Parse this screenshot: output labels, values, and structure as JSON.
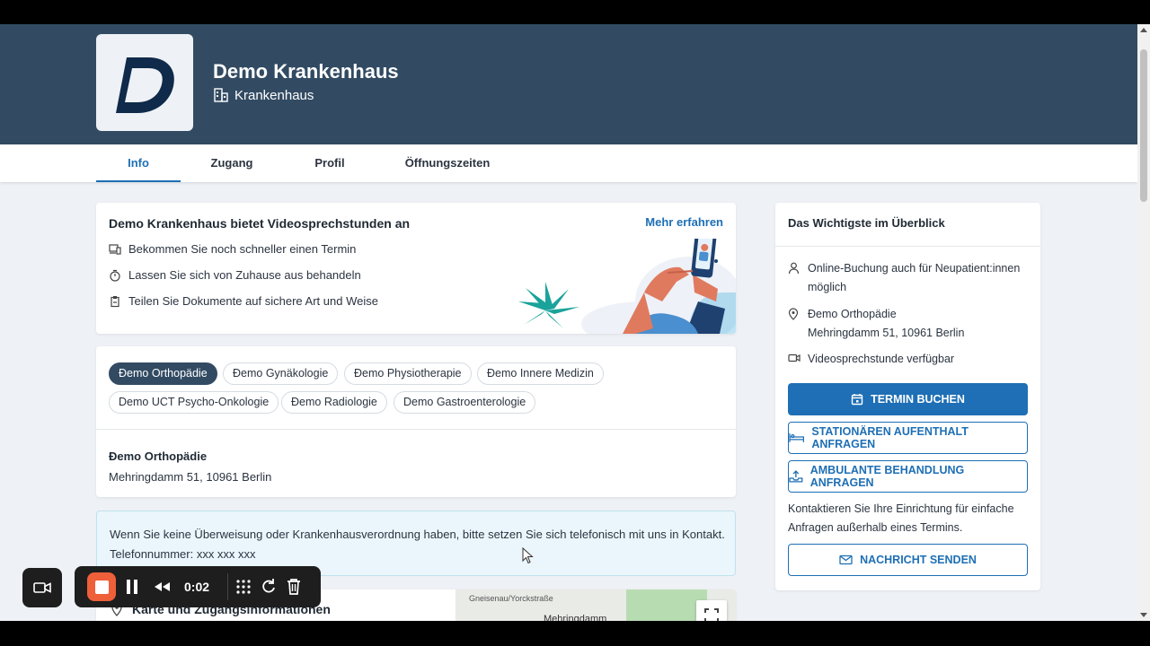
{
  "header": {
    "org_name": "Demo Krankenhaus",
    "org_type": "Krankenhaus",
    "logo_letter": "D"
  },
  "tabs": [
    {
      "label": "Info",
      "active": true
    },
    {
      "label": "Zugang",
      "active": false
    },
    {
      "label": "Profil",
      "active": false
    },
    {
      "label": "Öffnungszeiten",
      "active": false
    }
  ],
  "video_card": {
    "title": "Demo Krankenhaus bietet Videosprechstunden an",
    "more_link": "Mehr erfahren",
    "features": [
      {
        "icon": "devices-icon",
        "text": "Bekommen Sie noch schneller einen Termin"
      },
      {
        "icon": "timer-icon",
        "text": "Lassen Sie sich von Zuhause aus behandeln"
      },
      {
        "icon": "clipboard-icon",
        "text": "Teilen Sie Dokumente auf sichere Art und Weise"
      }
    ]
  },
  "locations": {
    "chips": [
      {
        "label": "Đemo Orthopädie",
        "active": true
      },
      {
        "label": "Đemo Gynäkologie",
        "active": false
      },
      {
        "label": "Đemo Physiotherapie",
        "active": false
      },
      {
        "label": "Đemo Innere Medizin",
        "active": false
      },
      {
        "label": "Demo UCT Psycho-Onkologie",
        "active": false
      },
      {
        "label": "Đemo Radiologie",
        "active": false
      },
      {
        "label": "Demo Gastroenterologie",
        "active": false
      }
    ],
    "selected_name": "Đemo Orthopädie",
    "selected_address": "Mehringdamm 51, 10961 Berlin"
  },
  "notice": {
    "line1": "Wenn Sie keine Überweisung oder Krankenhausverordnung haben, bitte setzen Sie sich telefonisch mit uns in Kontakt.",
    "line2": "Telefonnummer: xxx xxx xxx"
  },
  "map_card": {
    "title": "Karte und Zugangsinformationen",
    "road1": "Gneisenau/Yorckstraße",
    "road2": "Mehringdamm"
  },
  "sidebar": {
    "title": "Das Wichtigste im Überblick",
    "rows": [
      {
        "icon": "person-icon",
        "text": "Online-Buchung auch für Neupatient:innen möglich"
      },
      {
        "icon": "location-pin-icon",
        "text": "Đemo Orthopädie\nMehringdamm 51, 10961 Berlin"
      },
      {
        "icon": "video-camera-icon",
        "text": "Videosprechstunde verfügbar"
      }
    ],
    "buttons": {
      "book": "Termin buchen",
      "inpatient": "Stationären Aufenthalt anfragen",
      "outpatient": "Ambulante Behandlung anfragen",
      "message": "Nachricht senden"
    },
    "contact_note": "Kontaktieren Sie Ihre Einrichtung für einfache Anfragen außerhalb eines Termins."
  },
  "recorder": {
    "time": "0:02"
  },
  "colors": {
    "header_bg": "#324b63",
    "primary": "#1e6fb5",
    "record": "#ef5f3a"
  }
}
